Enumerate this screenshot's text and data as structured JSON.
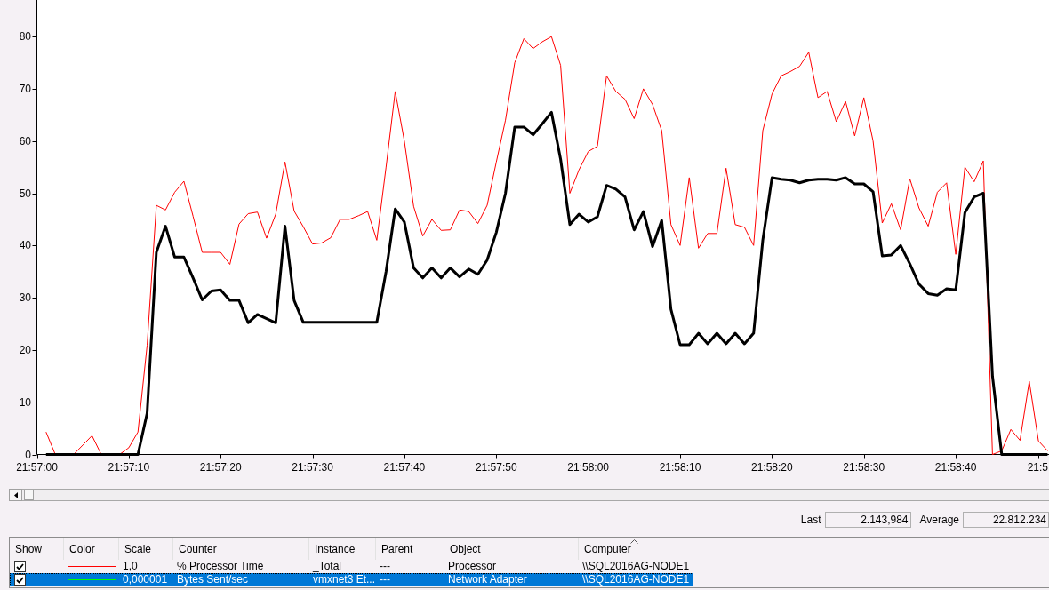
{
  "chart": {
    "chart_data": {
      "type": "line",
      "categories": [
        "21:57:00",
        null,
        null,
        null,
        null,
        null,
        null,
        null,
        null,
        null,
        "21:57:10",
        null,
        null,
        null,
        null,
        null,
        null,
        null,
        null,
        null,
        "21:57:20",
        null,
        null,
        null,
        null,
        null,
        null,
        null,
        null,
        null,
        "21:57:30",
        null,
        null,
        null,
        null,
        null,
        null,
        null,
        null,
        null,
        "21:57:40",
        null,
        null,
        null,
        null,
        null,
        null,
        null,
        null,
        null,
        "21:57:50",
        null,
        null,
        null,
        null,
        null,
        null,
        null,
        null,
        null,
        "21:58:00",
        null,
        null,
        null,
        null,
        null,
        null,
        null,
        null,
        null,
        "21:58:10",
        null,
        null,
        null,
        null,
        null,
        null,
        null,
        null,
        null,
        "21:58:20",
        null,
        null,
        null,
        null,
        null,
        null,
        null,
        null,
        null,
        "21:58:30",
        null,
        null,
        null,
        null,
        null,
        null,
        null,
        null,
        null,
        "21:58:40",
        null,
        null,
        null,
        null,
        null,
        null,
        null,
        null,
        "21:5",
        null
      ],
      "ylim": [
        0,
        87
      ],
      "yticks": [
        0,
        10,
        20,
        30,
        40,
        50,
        60,
        70,
        80
      ],
      "series": [
        {
          "name": "% Processor Time",
          "color": "#ff0000",
          "values": [
            null,
            4.3,
            0,
            0,
            0,
            1.8,
            3.6,
            0,
            0,
            0,
            1.3,
            4.3,
            20.9,
            47.7,
            46.8,
            50.2,
            52.3,
            45.6,
            38.7,
            38.7,
            38.7,
            36.4,
            44.1,
            46.1,
            46.4,
            41.4,
            46,
            56,
            46.6,
            43.6,
            40.3,
            40.5,
            41.5,
            45,
            45,
            45.7,
            46.5,
            41,
            55,
            69.5,
            60,
            47.5,
            41.8,
            45,
            42.9,
            43,
            46.8,
            46.5,
            44.2,
            47.7,
            56,
            64,
            75,
            79.6,
            77.7,
            79,
            80,
            74.5,
            50,
            54.5,
            58,
            59,
            72.5,
            69.5,
            68,
            64.3,
            70,
            67,
            62,
            44,
            40,
            53,
            39.5,
            42.3,
            42.3,
            54.8,
            44,
            43.5,
            40,
            62,
            69,
            72.5,
            73.3,
            74.3,
            77,
            68.3,
            69.5,
            63.7,
            67.6,
            61,
            68.3,
            60,
            44.3,
            48,
            43,
            52.8,
            47.2,
            43.7,
            50.2,
            52,
            38.3,
            55,
            52.2,
            56.2,
            0,
            0.7,
            4.8,
            2.7,
            14,
            2.6,
            0.7
          ]
        },
        {
          "name": "Bytes Sent/sec",
          "color": "#000000",
          "values": [
            null,
            0,
            0,
            0,
            0,
            0,
            0,
            0,
            0,
            0,
            0,
            0,
            7.9,
            38.7,
            43.7,
            37.8,
            37.8,
            33.8,
            29.6,
            31.3,
            31.5,
            29.5,
            29.5,
            25.2,
            26.8,
            26,
            25.2,
            43.7,
            29.5,
            25.3,
            25.3,
            25.3,
            25.3,
            25.3,
            25.3,
            25.3,
            25.3,
            25.3,
            35,
            47,
            44.5,
            35.7,
            33.8,
            35.7,
            33.8,
            35.7,
            34,
            35.5,
            34.5,
            37.2,
            42.5,
            50,
            62.7,
            62.7,
            61.2,
            63.3,
            65.5,
            56.5,
            44,
            46,
            44.5,
            45.5,
            51.5,
            50.8,
            49.3,
            43,
            46.5,
            39.8,
            44.8,
            27.8,
            21,
            21,
            23.2,
            21.2,
            23.2,
            21.2,
            23.2,
            21.2,
            23.2,
            41,
            53,
            52.7,
            52.5,
            52,
            52.5,
            52.7,
            52.7,
            52.5,
            53,
            51.8,
            51.8,
            50.3,
            38,
            38.2,
            40,
            36.5,
            32.6,
            30.8,
            30.5,
            31.7,
            31.5,
            46.3,
            49.3,
            50,
            15,
            0,
            0,
            0,
            0,
            0,
            0
          ]
        }
      ]
    }
  },
  "stats": [
    {
      "label": "Last",
      "value": "2.143,984"
    },
    {
      "label": "Average",
      "value": "22.812.234"
    }
  ],
  "counters_table": {
    "columns": [
      {
        "label": "Show",
        "sorted": false
      },
      {
        "label": "Color",
        "sorted": false
      },
      {
        "label": "Scale",
        "sorted": false
      },
      {
        "label": "Counter",
        "sorted": false
      },
      {
        "label": "Instance",
        "sorted": false
      },
      {
        "label": "Parent",
        "sorted": false
      },
      {
        "label": "Object",
        "sorted": false
      },
      {
        "label": "Computer",
        "sorted": true
      }
    ],
    "rows": [
      {
        "show": true,
        "color": "#ff0000",
        "scale": "1,0",
        "instance": "_Total",
        "parent": "---",
        "object": "Processor",
        "computer": "\\\\SQL2016AG-NODE1",
        "selected": false
      },
      {
        "show": true,
        "color": "#00ff00",
        "scale": "0,000001",
        "instance": "vmxnet3 Et...",
        "parent": "---",
        "object": "Network Adapter",
        "computer": "\\\\SQL2016AG-NODE1",
        "selected": true
      }
    ]
  }
}
